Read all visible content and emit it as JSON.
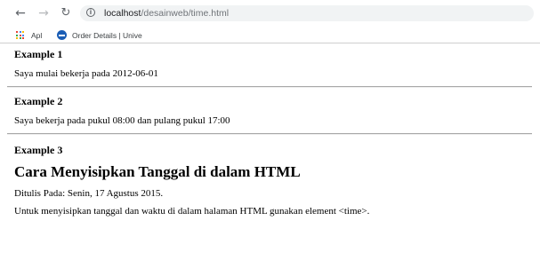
{
  "browser": {
    "url_host": "localhost",
    "url_path": "/desainweb/time.html",
    "bookmarks": [
      {
        "label": "Apl"
      },
      {
        "label": "Order Details | Unive"
      }
    ]
  },
  "sections": [
    {
      "heading": "Example 1",
      "text": "Saya mulai bekerja pada 2012-06-01"
    },
    {
      "heading": "Example 2",
      "text": "Saya bekerja pada pukul 08:00 dan pulang pukul 17:00"
    },
    {
      "heading": "Example 3",
      "article_title": "Cara Menyisipkan Tanggal di dalam HTML",
      "byline": "Ditulis Pada: Senin, 17 Agustus 2015.",
      "body": "Untuk menyisipkan tanggal dan waktu di dalam halaman HTML gunakan element <time>."
    }
  ],
  "colors": {
    "apps_grid": [
      "#ea4335",
      "#4285f4",
      "#fbbc05",
      "#34a853",
      "#ea4335",
      "#4285f4",
      "#fbbc05",
      "#34a853",
      "#ea4335"
    ],
    "ebay_icon": "#1a5db5"
  },
  "icons": {
    "back": "arrow-left-icon",
    "forward": "arrow-right-icon",
    "reload": "reload-icon",
    "site_info": "info-icon",
    "apps": "apps-grid-icon",
    "order_details": "ebay-icon"
  }
}
